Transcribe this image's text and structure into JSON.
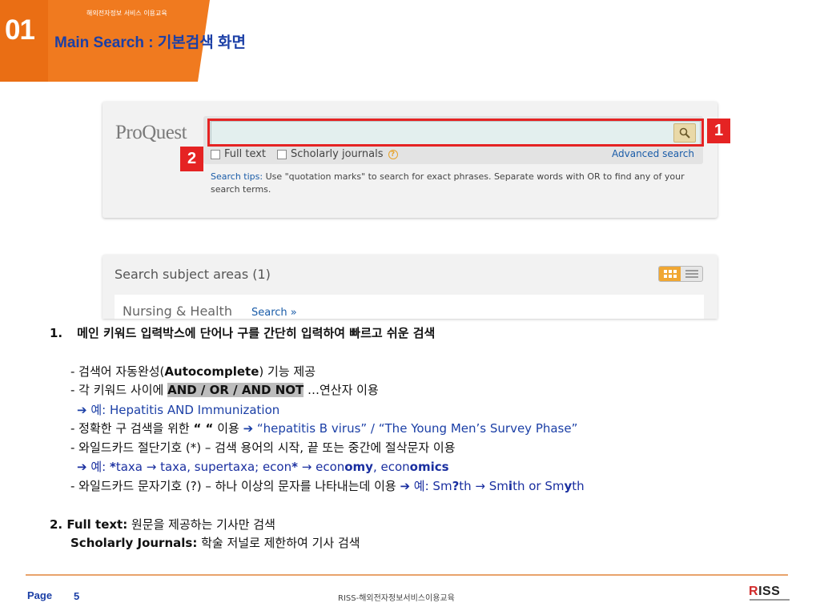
{
  "header": {
    "slide_number": "01",
    "course_label": "해외전자정보 서비스 이용교육",
    "title": "Main Search : 기본검색 화면",
    "accent_color": "#f07a1f"
  },
  "screenshot": {
    "logo": "ProQuest",
    "search_icon": "magnifier-icon",
    "full_text_label": "Full text",
    "scholarly_label": "Scholarly journals",
    "advanced_search": "Advanced search",
    "tips_label": "Search tips:",
    "tips_text": " Use \"quotation marks\" to search for exact phrases. Separate words with OR to find any of your search terms.",
    "subject_title": "Search subject areas (1)",
    "subject_name": "Nursing & Health",
    "subject_search": "Search »",
    "badge1": "1",
    "badge2": "2"
  },
  "content": {
    "item1_num": "1.",
    "item1_text": "메인 키워드 입력박스에 단어나 구를 간단히 입력하여 빠르고 쉬운 검색",
    "l2_a": "- 검색어 자동완성(",
    "l2_b": "Autocomplete",
    "l2_c": ") 기능 제공",
    "l3_a": "- 각 키워드 사이에 ",
    "l3_b": "AND / OR / AND NOT",
    "l3_c": " …연산자 이용",
    "l4": "➔ 예: Hepatitis AND Immunization",
    "l5_a": "- 정확한 구 검색을 위한 ",
    "l5_b": "“      “",
    "l5_c": " 이용  ",
    "l5_d": "➔ “hepatitis B virus” / “The Young Men’s Survey Phase”",
    "l6": "- 와일드카드 절단기호 (*) – 검색 용어의 시작, 끝 또는 중간에 절삭문자 이용",
    "l7_a": "➔ 예: ",
    "l7_b": "*",
    "l7_c": "taxa → taxa, supertaxa; econ",
    "l7_d": "*",
    "l7_e": " → econ",
    "l7_f": "omy",
    "l7_g": ", econ",
    "l7_h": "omics",
    "l8_a": "- 와일드카드 문자기호 (?) – 하나 이상의 문자를 나타내는데 이용 ",
    "l8_b": "➔ 예: Sm",
    "l8_c": "?",
    "l8_d": "th → Sm",
    "l8_e": "i",
    "l8_f": "th or Sm",
    "l8_g": "y",
    "l8_h": "th",
    "item2_a": "2. Full text:",
    "item2_b": " 원문을 제공하는 기사만 검색",
    "item2c_a": "Scholarly Journals:",
    "item2c_b": " 학술 저널로 제한하여 기사 검색"
  },
  "footer": {
    "page_label": "Page",
    "page_number": "5",
    "center_text": "RISS-해외전자정보서비스이용교육",
    "logo": "RISS"
  }
}
